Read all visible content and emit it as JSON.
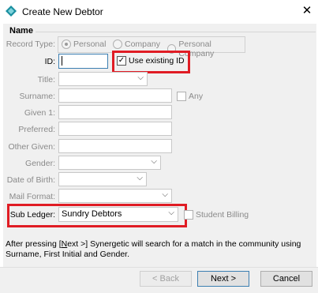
{
  "window": {
    "title": "Create New Debtor",
    "close_icon": "close-icon"
  },
  "section": {
    "name": "Name"
  },
  "record_type": {
    "label": "Record Type:",
    "options": [
      "Personal",
      "Company",
      "Personal Company"
    ],
    "selected": "Personal"
  },
  "fields": {
    "id_label": "ID:",
    "use_existing_id": "Use existing ID",
    "title_label": "Title:",
    "surname_label": "Surname:",
    "any_label": "Any",
    "given1_label": "Given 1:",
    "preferred_label": "Preferred:",
    "other_given_label": "Other Given:",
    "gender_label": "Gender:",
    "dob_label": "Date of Birth:",
    "mail_format_label": "Mail Format:",
    "sub_ledger_label": "Sub Ledger:",
    "sub_ledger_value": "Sundry Debtors",
    "student_billing_label": "Student Billing"
  },
  "info": {
    "prefix": "After pressing [",
    "next_underlined": "N",
    "suffix": "ext >] Synergetic will search for a match in the community using Surname, First Initial and Gender."
  },
  "buttons": {
    "back": "< Back",
    "next": "Next >",
    "cancel": "Cancel"
  },
  "colors": {
    "highlight": "#e01c24",
    "focus_border": "#3c7fb1"
  }
}
